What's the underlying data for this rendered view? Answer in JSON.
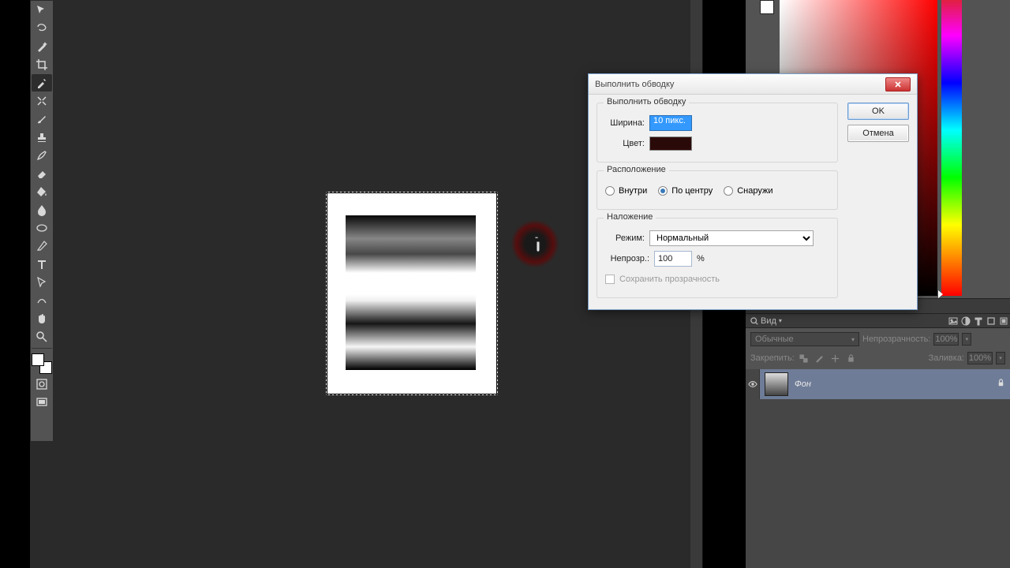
{
  "dialog": {
    "title": "Выполнить обводку",
    "ok": "OK",
    "cancel": "Отмена",
    "group_stroke": {
      "title": "Выполнить обводку",
      "width_label": "Ширина:",
      "width_value": "10 пикс.",
      "color_label": "Цвет:",
      "color_value": "#2a0a08"
    },
    "group_location": {
      "title": "Расположение",
      "inside": "Внутри",
      "center": "По центру",
      "outside": "Снаружи",
      "selected": "center"
    },
    "group_blend": {
      "title": "Наложение",
      "mode_label": "Режим:",
      "mode_value": "Нормальный",
      "opacity_label": "Непрозр.:",
      "opacity_value": "100",
      "percent": "%",
      "preserve_transparency": "Сохранить прозрачность"
    }
  },
  "layers": {
    "tab_label": "Вид",
    "blend_mode": "Обычные",
    "opacity_label": "Непрозрачность:",
    "opacity_value": "100%",
    "lock_label": "Закрепить:",
    "fill_label": "Заливка:",
    "fill_value": "100%",
    "layer_name": "Фон"
  }
}
